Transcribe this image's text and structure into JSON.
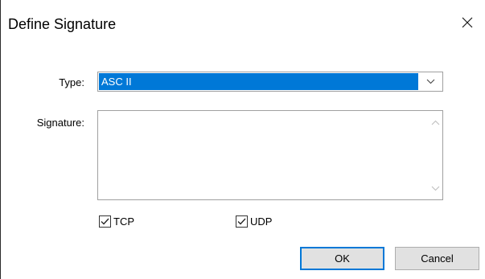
{
  "dialog": {
    "title": "Define Signature"
  },
  "form": {
    "type_label": "Type:",
    "type_value": "ASC II",
    "signature_label": "Signature:",
    "signature_value": ""
  },
  "protocols": {
    "tcp": {
      "label": "TCP",
      "checked": true
    },
    "udp": {
      "label": "UDP",
      "checked": true
    }
  },
  "buttons": {
    "ok_label": "OK",
    "cancel_label": "Cancel"
  },
  "colors": {
    "selection": "#0078d7",
    "button_face": "#e1e1e1",
    "default_button_border": "#0078d7"
  },
  "icons": {
    "close": "close-icon",
    "dropdown": "chevron-down-icon",
    "scroll_up": "chevron-up-icon",
    "scroll_down": "chevron-down-icon",
    "check": "checkmark-icon"
  }
}
